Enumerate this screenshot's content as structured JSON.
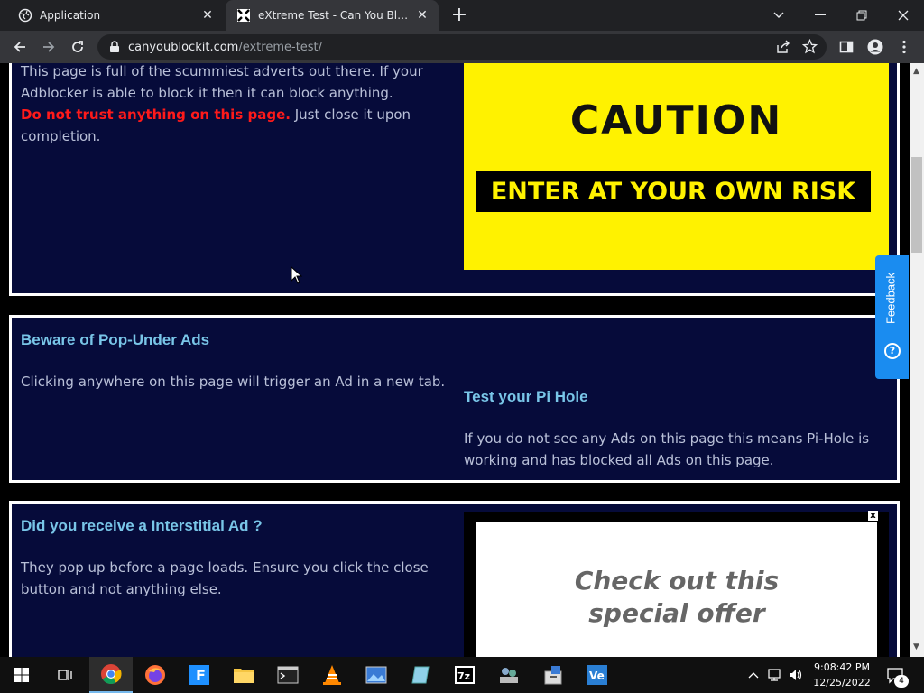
{
  "browser": {
    "tabs": [
      {
        "label": "Application",
        "active": false
      },
      {
        "label": "eXtreme Test - Can You Block It ?",
        "active": true
      }
    ],
    "url_host": "canyoublockit.com",
    "url_path": "/extreme-test/"
  },
  "sections": {
    "intro": {
      "line1": "This page is full of the scummiest adverts out there. If your",
      "line2": "Adblocker is able to block it then it can block anything.",
      "warning": "Do not trust anything on this page.",
      "line3": " Just close it upon",
      "line4": "completion."
    },
    "caution": {
      "title": "CAUTION",
      "subtitle": "ENTER AT YOUR OWN RISK",
      "color_bg": "#fff200"
    },
    "popunder": {
      "heading": "Beware of Pop-Under Ads",
      "text": "Clicking anywhere on this page will trigger an Ad in a new tab."
    },
    "pihole": {
      "heading": "Test your Pi Hole",
      "line1": "If you do not see any Ads on this page this means Pi-Hole is",
      "line2": "working and has blocked all Ads on this page."
    },
    "interstitial": {
      "heading": "Did you receive a Interstitial Ad ?",
      "line1": "They pop up before a page loads. Ensure you click the close",
      "line2": "button and not anything else."
    },
    "ad": {
      "close": "x",
      "line1": "Check out this",
      "line2": "special offer"
    }
  },
  "feedback": {
    "label": "Feedback"
  },
  "taskbar": {
    "icons": [
      "windows-start-icon",
      "task-view-icon",
      "chrome-icon",
      "firefox-icon",
      "app-f-icon",
      "file-explorer-icon",
      "terminal-icon",
      "vlc-icon",
      "photos-icon",
      "notepad-icon",
      "7zip-icon",
      "network-app-icon",
      "installer-icon",
      "vs-code-icon"
    ],
    "time": "9:08:42 PM",
    "date": "12/25/2022",
    "notifications": "4"
  },
  "colors": {
    "page_bg": "#060b3a",
    "heading": "#79c6e8",
    "warning": "#ff1a1a"
  }
}
